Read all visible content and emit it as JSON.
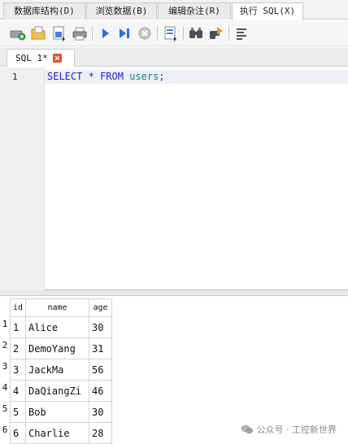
{
  "menu": {
    "tabs": [
      {
        "label": "数据库结构(D)"
      },
      {
        "label": "浏览数据(B)"
      },
      {
        "label": "编辑杂注(R)"
      },
      {
        "label": "执行 SQL(X)"
      }
    ],
    "active_index": 3
  },
  "toolbar": {
    "icons": [
      "open-tab-icon",
      "open-file-icon",
      "save-icon",
      "print-icon",
      "execute-all-icon",
      "execute-line-icon",
      "stop-icon",
      "save-results-icon",
      "find-icon",
      "find-replace-icon",
      "comment-icon"
    ]
  },
  "editor": {
    "tab_label": "SQL 1*",
    "line_number": "1",
    "code": {
      "select": "SELECT",
      "star": "*",
      "from": "FROM",
      "table": "users",
      "semicolon": ";"
    }
  },
  "results": {
    "columns": [
      "id",
      "name",
      "age"
    ],
    "rows": [
      {
        "row_number": "1",
        "id": "1",
        "name": "Alice",
        "age": "30"
      },
      {
        "row_number": "2",
        "id": "2",
        "name": "DemoYang",
        "age": "31"
      },
      {
        "row_number": "3",
        "id": "3",
        "name": "JackMa",
        "age": "56"
      },
      {
        "row_number": "4",
        "id": "4",
        "name": "DaQiangZi",
        "age": "46"
      },
      {
        "row_number": "5",
        "id": "5",
        "name": "Bob",
        "age": "30"
      },
      {
        "row_number": "6",
        "id": "6",
        "name": "Charlie",
        "age": "28"
      }
    ]
  },
  "watermark": {
    "text": "公众号 · 工控新世界"
  },
  "colors": {
    "keyword": "#1f1fc8",
    "identifier": "#0b7e83",
    "close_button": "#e0502d",
    "play_icon": "#2a6fd6"
  }
}
